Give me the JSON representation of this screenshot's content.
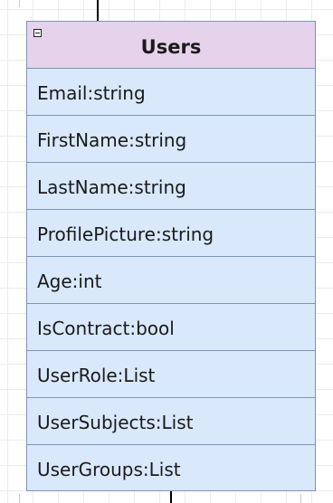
{
  "class_box": {
    "title": "Users",
    "collapse_symbol": "minus",
    "header_color": "#e6d2ea",
    "body_color": "#d9e8fb",
    "border_color": "#7f94b8",
    "attributes": [
      "Email:string",
      "FirstName:string",
      "LastName:string",
      "ProfilePicture:string",
      "Age:int",
      "IsContract:bool",
      "UserRole:List",
      "UserSubjects:List",
      "UserGroups:List"
    ]
  }
}
